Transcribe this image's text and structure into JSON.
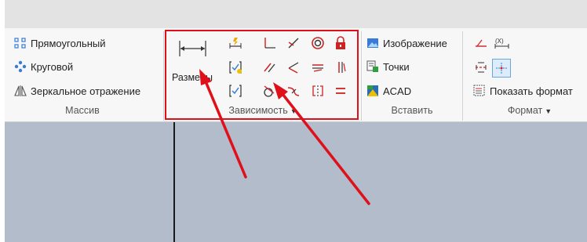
{
  "ribbon": {
    "array_group": {
      "label": "Массив",
      "items": [
        {
          "label": "Прямоугольный",
          "icon": "rectangular-array-icon"
        },
        {
          "label": "Круговой",
          "icon": "circular-array-icon"
        },
        {
          "label": "Зеркальное отражение",
          "icon": "mirror-icon"
        }
      ]
    },
    "constraint_group": {
      "label": "Зависимость",
      "dimension_button_label": "Размеры",
      "icons": [
        "dimension-icon",
        "auto-dimension-icon",
        "coincident-icon",
        "collinear-icon",
        "concentric-icon",
        "fix-icon",
        "show-constraints-icon",
        "parallel-icon",
        "perpendicular-icon",
        "horizontal-icon",
        "vertical-icon",
        "constraint-inference-icon",
        "tangent-icon",
        "smooth-icon",
        "symmetric-icon",
        "equal-icon"
      ]
    },
    "insert_group": {
      "label": "Вставить",
      "items": [
        {
          "label": "Изображение",
          "icon": "image-icon"
        },
        {
          "label": "Точки",
          "icon": "points-icon"
        },
        {
          "label": "ACAD",
          "icon": "acad-icon"
        }
      ]
    },
    "format_group": {
      "label": "Формат",
      "show_format_label": "Показать формат"
    }
  },
  "colors": {
    "highlight_box": "#e0101b",
    "arrow": "#e0101b",
    "canvas": "#b2bccb"
  }
}
